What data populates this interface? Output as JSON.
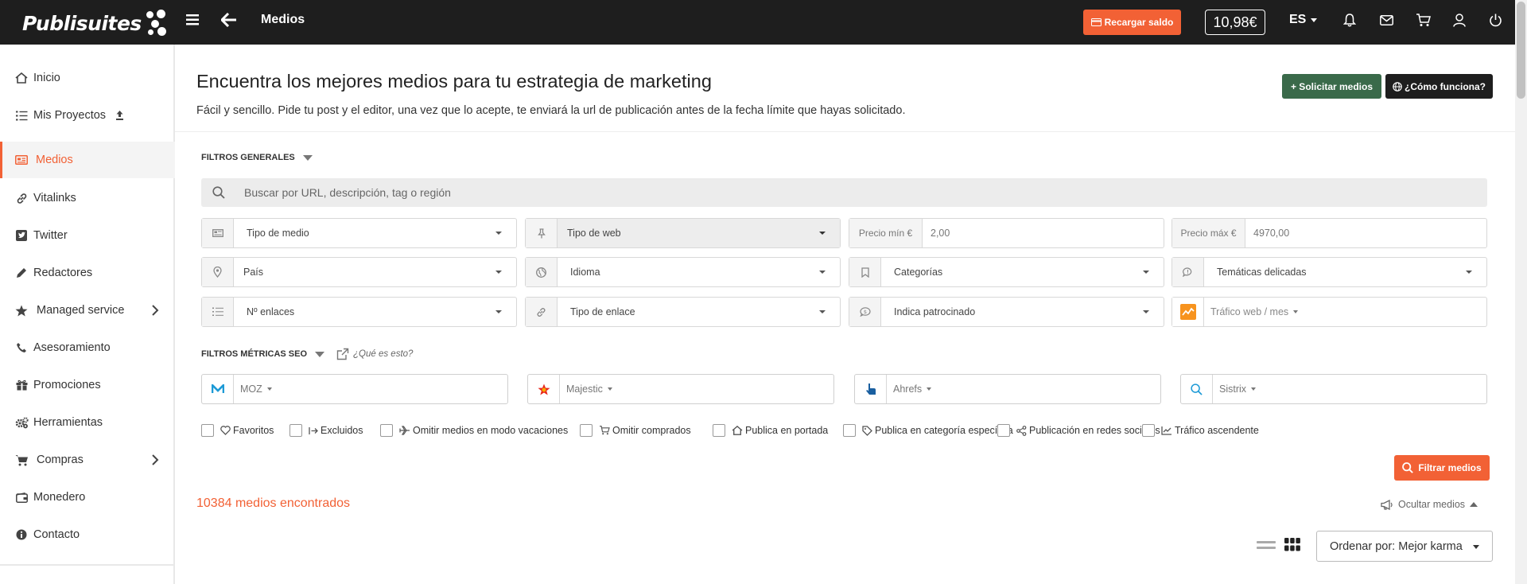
{
  "topbar": {
    "logo_text": "Publisuites",
    "page_title": "Medios",
    "recharge_label": "Recargar saldo",
    "balance": "10,98€",
    "language": "ES"
  },
  "sidebar": {
    "items": [
      {
        "label": "Inicio",
        "icon": "home-icon"
      },
      {
        "label": "Mis Proyectos",
        "icon": "list-icon"
      },
      {
        "label": "Medios",
        "icon": "newspaper-icon",
        "active": true
      },
      {
        "label": "Vitalinks",
        "icon": "link-icon"
      },
      {
        "label": "Twitter",
        "icon": "twitter-icon"
      },
      {
        "label": "Redactores",
        "icon": "pencil-icon"
      },
      {
        "label": "Managed service",
        "icon": "star-icon"
      },
      {
        "label": "Asesoramiento",
        "icon": "phone-icon"
      },
      {
        "label": "Promociones",
        "icon": "gift-icon"
      },
      {
        "label": "Herramientas",
        "icon": "cogs-icon"
      },
      {
        "label": "Compras",
        "icon": "cart-icon"
      },
      {
        "label": "Monedero",
        "icon": "wallet-icon"
      },
      {
        "label": "Contacto",
        "icon": "info-icon"
      }
    ]
  },
  "header": {
    "title": "Encuentra los mejores medios para tu estrategia de marketing",
    "subtitle": "Fácil y sencillo. Pide tu post y el editor, una vez que lo acepte, te enviará la url de publicación antes de la fecha límite que hayas solicitado.",
    "request_button": "+ Solicitar medios",
    "how_button": "¿Cómo funciona?"
  },
  "filters": {
    "general_title": "FILTROS GENERALES",
    "search_placeholder": "Buscar por URL, descripción, tag o región",
    "tipo_medio": "Tipo de medio",
    "tipo_web": "Tipo de web",
    "precio_min_label": "Precio mín €",
    "precio_min_value": "2,00",
    "precio_max_label": "Precio máx €",
    "precio_max_value": "4970,00",
    "pais": "País",
    "idioma": "Idioma",
    "categorias": "Categorías",
    "tematicas": "Temáticas delicadas",
    "n_enlaces": "Nº enlaces",
    "tipo_enlace": "Tipo de enlace",
    "patrocinado": "Indica patrocinado",
    "trafico": "Tráfico web / mes",
    "seo_title": "FILTROS MÉTRICAS SEO",
    "que_es": "¿Qué es esto?",
    "moz": "MOZ",
    "majestic": "Majestic",
    "ahrefs": "Ahrefs",
    "sistrix": "Sistrix",
    "checkboxes": [
      {
        "label": "Favoritos",
        "icon": "heart-icon"
      },
      {
        "label": "Excluidos",
        "icon": "exit-icon"
      },
      {
        "label": "Omitir medios en modo vacaciones",
        "icon": "plane-icon"
      },
      {
        "label": "Omitir comprados",
        "icon": "cart-icon"
      },
      {
        "label": "Publica en portada",
        "icon": "home-icon"
      },
      {
        "label": "Publica en categoría específica",
        "icon": "tag-icon"
      },
      {
        "label": "Publicación en redes sociales",
        "icon": "share-icon"
      },
      {
        "label": "Tráfico ascendente",
        "icon": "chart-line-icon"
      }
    ],
    "filter_button": "Filtrar medios"
  },
  "results": {
    "count_text": "10384 medios encontrados",
    "hide_label": "Ocultar medios",
    "sort_label": "Ordenar por: Mejor karma"
  },
  "colors": {
    "accent": "#f26135",
    "topbar": "#1e1e1e",
    "green_button": "#3a6a4a"
  }
}
